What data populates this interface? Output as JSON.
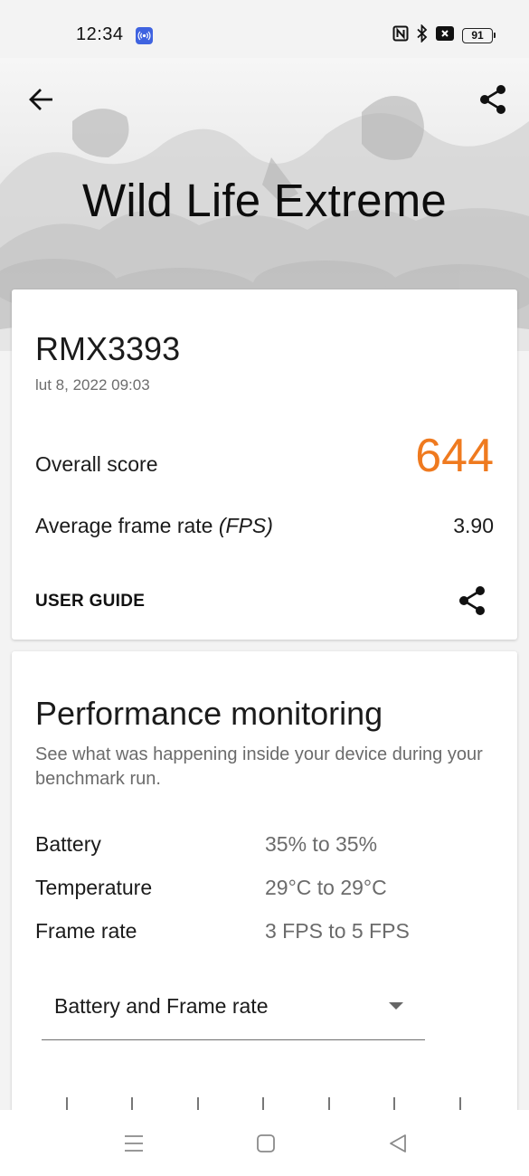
{
  "status_bar": {
    "time": "12:34",
    "battery_level": "91",
    "icons": [
      "broadcast-app-icon",
      "nfc-icon",
      "bluetooth-icon",
      "silent-icon",
      "battery-icon"
    ]
  },
  "hero": {
    "title": "Wild Life Extreme",
    "back_icon": "arrow-left-icon",
    "share_icon": "share-icon"
  },
  "result": {
    "device_name": "RMX3393",
    "run_date": "lut 8, 2022 09:03",
    "overall_score_label": "Overall score",
    "overall_score_value": "644",
    "fps_label": "Average frame rate",
    "fps_unit": "(FPS)",
    "fps_value": "3.90",
    "user_guide_label": "USER GUIDE",
    "score_color": "#ef7a1f"
  },
  "performance": {
    "title": "Performance monitoring",
    "description": "See what was happening inside your device during your benchmark run.",
    "metrics": [
      {
        "label": "Battery",
        "value": "35% to 35%"
      },
      {
        "label": "Temperature",
        "value": "29°C to 29°C"
      },
      {
        "label": "Frame rate",
        "value": "3 FPS to 5 FPS"
      }
    ],
    "chart_selector": {
      "selected": "Battery and Frame rate"
    }
  },
  "nav_bar": {
    "icons": [
      "menu-icon",
      "home-icon",
      "back-triangle-icon"
    ]
  }
}
